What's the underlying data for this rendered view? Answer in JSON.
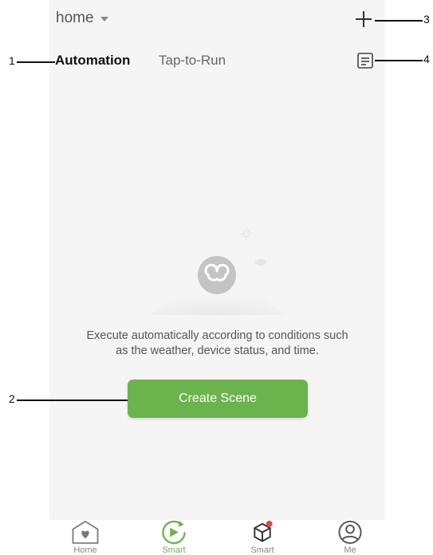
{
  "header": {
    "home_label": "home"
  },
  "tabs": [
    {
      "label": "Automation",
      "active": true
    },
    {
      "label": "Tap-to-Run",
      "active": false
    }
  ],
  "empty_state": {
    "message_line1": "Execute automatically according to conditions such",
    "message_line2": "as the weather, device status, and time."
  },
  "create_button": {
    "label": "Create Scene"
  },
  "bottom_nav": [
    {
      "label": "Home",
      "icon": "home-icon",
      "active": false
    },
    {
      "label": "Smart",
      "icon": "smart-icon",
      "active": true
    },
    {
      "label": "Smart",
      "icon": "cube-icon",
      "active": false,
      "badge": true
    },
    {
      "label": "Me",
      "icon": "profile-icon",
      "active": false
    }
  ],
  "annotations": [
    "1",
    "2",
    "3",
    "4"
  ],
  "colors": {
    "accent": "#6bb34d",
    "background": "#f5f5f5",
    "badge": "#e5433f"
  }
}
